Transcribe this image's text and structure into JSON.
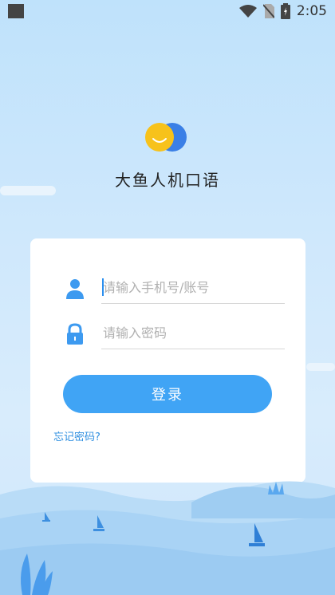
{
  "statusbar": {
    "time": "2:05"
  },
  "app": {
    "name": "大鱼人机口语"
  },
  "login": {
    "username_placeholder": "请输入手机号/账号",
    "password_placeholder": "请输入密码",
    "submit_label": "登录",
    "forgot_password": "忘记密码?"
  },
  "colors": {
    "accent": "#40a4f5",
    "logo_yellow": "#f7c21b",
    "logo_blue": "#3a7fe6"
  },
  "icons": [
    "wifi-icon",
    "no-sim-icon",
    "battery-icon",
    "user-icon",
    "lock-icon"
  ]
}
